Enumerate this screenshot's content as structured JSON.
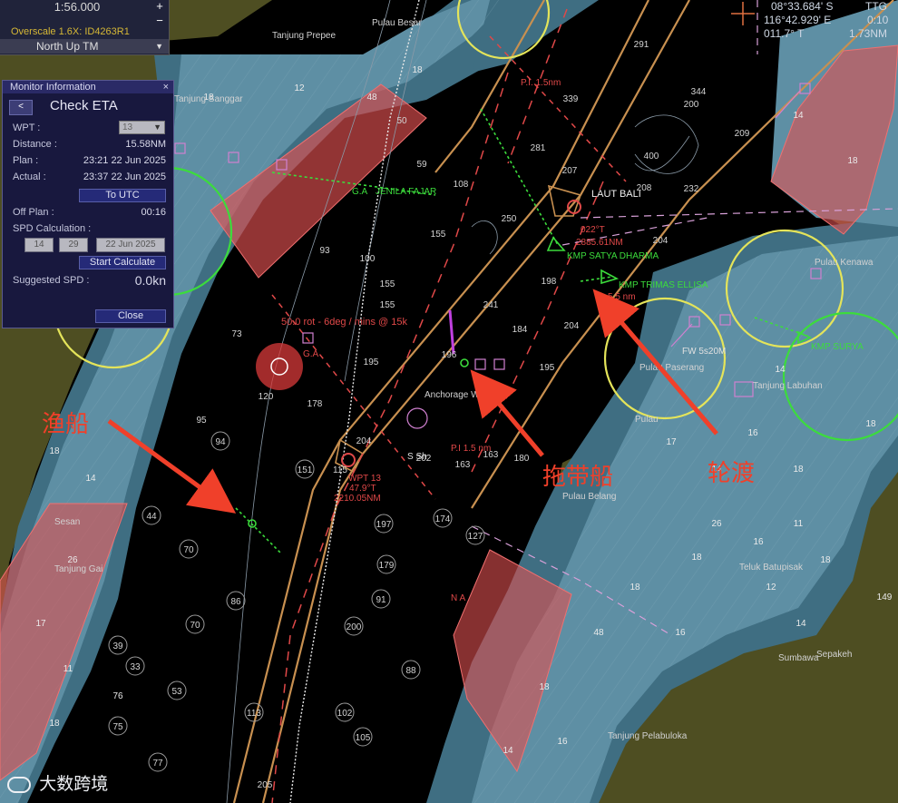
{
  "scale": {
    "value": "1:56.000",
    "plus": "+",
    "minus": "−"
  },
  "overscale": "Overscale 1.6X: ID4263R1",
  "orientation": "North Up TM",
  "position": {
    "lat": "08°33.684' S",
    "lon": "116°42.929' E",
    "course": "011.7° T",
    "ttg_label": "TTG",
    "ttg_value": "0:10",
    "dist": "1.73NM"
  },
  "monitor": {
    "header": "Monitor Information",
    "close_x": "×",
    "back": "<",
    "title": "Check ETA",
    "wpt_label": "WPT :",
    "wpt_value": "13",
    "distance_label": "Distance :",
    "distance_value": "15.58NM",
    "plan_label": "Plan :",
    "plan_value": "23:21 22 Jun 2025",
    "actual_label": "Actual :",
    "actual_value": "23:37 22 Jun 2025",
    "to_utc": "To UTC",
    "offplan_label": "Off Plan :",
    "offplan_value": "00:16",
    "spd_calc_label": "SPD Calculation :",
    "calc_hour": "14",
    "calc_min": "29",
    "calc_date": "22 Jun 2025",
    "start_calc": "Start Calculate",
    "suggested_label": "Suggested SPD :",
    "suggested_value": "0.0kn",
    "close_button": "Close"
  },
  "place_names": {
    "tanjung_prepee": "Tanjung Prepee",
    "tanjung_sanggar": "Tanjung Sanggar",
    "laut_bali": "LAUT BALI",
    "pulau_besar": "Pulau Besar",
    "pulau_belang": "Pulau Belang",
    "teluk_batupisak": "Teluk Batupisak",
    "tanjung_gai": "Tanjung Gai",
    "tanjung_pelabuloka": "Tanjung Pelabuloka",
    "sepakeh": "Sepakeh",
    "sumbawa": "Sumbawa",
    "tanjung_labuhan": "Tanjung Labuhan",
    "pulau_kenawa": "Pulau Kenawa",
    "pulau_paserang": "Pulau Paserang",
    "pulau": "Pulau",
    "anchorage": "Anchorage Waters",
    "sesan": "Sesan"
  },
  "targets": {
    "jenila_fajar": "JENILA FAJAR",
    "satya_dharma": "KMP SATYA DHARMA",
    "satya_range": "2885.61NM",
    "satya_brg": "022°T",
    "trimas": "KMP TRIMAS ELLISA",
    "trimas_dist": "5.5 nm",
    "kenawa": "KMP SURYA",
    "rot_text": "50.0 rot - 6deg / mins @ 15k",
    "pi_top": "P.I. 1.5nm",
    "pi_mid": "P.I 1.5 nm",
    "wpt13": "WPT 13",
    "wpt_brg": "47.9°T",
    "wpt_dist": "2210.05NM",
    "fw": "FW 5s20M",
    "ga": "G.A",
    "ga2": "G.A",
    "pulau_lbl": "Pulau",
    "s_sh": "S Sh",
    "na": "N A"
  },
  "annotations": {
    "fishing": "渔船",
    "tug": "拖带船",
    "ferry": "轮渡"
  },
  "depths": {
    "d1": "291",
    "d2": "339",
    "d3": "344",
    "d4": "200",
    "d5": "209",
    "d6": "281",
    "d7": "207",
    "d8": "400",
    "d9": "232",
    "d10": "208",
    "d11": "204",
    "d12": "250",
    "d13": "155",
    "d14": "108",
    "d15": "59",
    "d16": "50",
    "d17": "93",
    "d18": "100",
    "d19": "155",
    "d20": "155",
    "d21": "241",
    "d22": "198",
    "d23": "184",
    "d24": "204",
    "d25": "195",
    "d26": "120",
    "d27": "178",
    "d28": "195",
    "d29": "204",
    "d30": "196",
    "d31": "163",
    "d32": "73",
    "d33": "95",
    "d34": "94",
    "d35": "151",
    "d36": "115",
    "d37": "197",
    "d38": "174",
    "d39": "179",
    "d40": "202",
    "d41": "163",
    "d42": "127",
    "d43": "180",
    "d44": "44",
    "d45": "70",
    "d46": "86",
    "d47": "70",
    "d48": "39",
    "d49": "33",
    "d50": "53",
    "d51": "75",
    "d52": "77",
    "d53": "91",
    "d54": "88",
    "d55": "102",
    "d56": "200",
    "d57": "113",
    "d58": "105",
    "d59": "205",
    "d60": "76",
    "d61": "18",
    "d62": "14",
    "d63": "16",
    "d64": "149",
    "d65": "17",
    "d66": "11",
    "d67": "26",
    "d68": "12",
    "d69": "48",
    "d70": "120"
  },
  "colors": {
    "land": "#4e4e22",
    "shallow": "#5e8da2",
    "mid": "#3e6e84",
    "deep": "#000000",
    "danger": "#e05050",
    "route": "#c89050",
    "ring_yellow": "#e4e45a",
    "ring_green": "#3cdc3c",
    "arrow": "#f0402a"
  }
}
